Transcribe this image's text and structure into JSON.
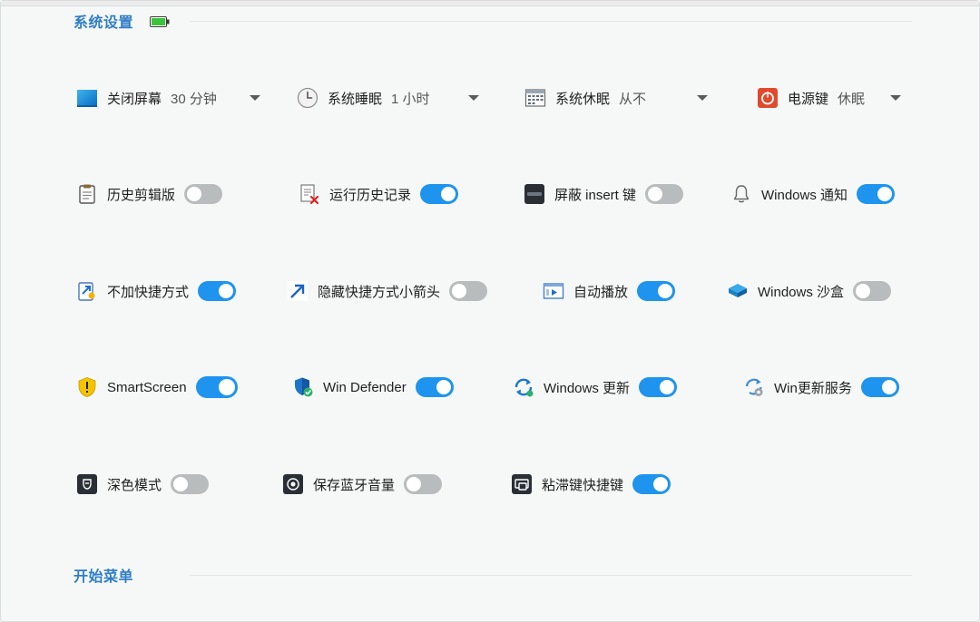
{
  "sections": {
    "system_settings": "系统设置",
    "start_menu": "开始菜单"
  },
  "power": [
    {
      "label": "关闭屏幕",
      "value": "30 分钟",
      "icon": "monitor-icon"
    },
    {
      "label": "系统睡眠",
      "value": "1 小时",
      "icon": "clock-icon"
    },
    {
      "label": "系统休眠",
      "value": "从不",
      "icon": "hibernate-icon"
    },
    {
      "label": "电源键",
      "value": "休眠",
      "icon": "power-button-icon"
    }
  ],
  "toggles": [
    {
      "label": "历史剪辑版",
      "on": false,
      "icon": "clipboard-icon"
    },
    {
      "label": "运行历史记录",
      "on": true,
      "icon": "run-history-icon"
    },
    {
      "label": "屏蔽 insert 键",
      "on": false,
      "icon": "insert-key-icon"
    },
    {
      "label": "Windows 通知",
      "on": true,
      "icon": "bell-icon"
    },
    {
      "label": "不加快捷方式",
      "on": true,
      "icon": "shortcut-icon"
    },
    {
      "label": "隐藏快捷方式小箭头",
      "on": false,
      "icon": "arrow-icon"
    },
    {
      "label": "自动播放",
      "on": true,
      "icon": "autoplay-icon"
    },
    {
      "label": "Windows 沙盒",
      "on": false,
      "icon": "sandbox-icon"
    },
    {
      "label": "SmartScreen",
      "on": true,
      "icon": "smartscreen-shield-icon"
    },
    {
      "label": "Win Defender",
      "on": true,
      "icon": "defender-shield-icon"
    },
    {
      "label": "Windows 更新",
      "on": true,
      "icon": "update-icon"
    },
    {
      "label": "Win更新服务",
      "on": true,
      "icon": "update-service-icon"
    },
    {
      "label": "深色模式",
      "on": false,
      "icon": "dark-mode-icon"
    },
    {
      "label": "保存蓝牙音量",
      "on": false,
      "icon": "bluetooth-volume-icon"
    },
    {
      "label": "粘滞键快捷键",
      "on": true,
      "icon": "sticky-keys-icon"
    }
  ],
  "colors": {
    "accent": "#2f7dc8",
    "toggle_on": "#1e94ef",
    "toggle_off": "#b9bcbd"
  }
}
